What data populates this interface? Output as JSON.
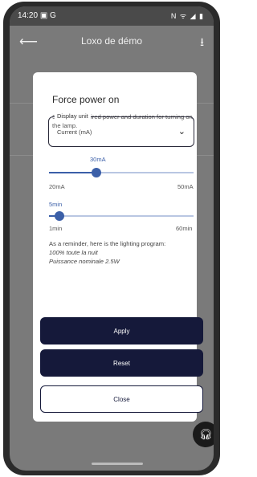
{
  "statusbar": {
    "time": "14:20",
    "left_icons": "▣ G",
    "right_icons": "N ᯤ ◢ ▮"
  },
  "appbar": {
    "title": "Loxo de démo"
  },
  "dialog": {
    "title": "Force power on",
    "description": "Select the desired power and duration for turning on the lamp.",
    "display_unit": {
      "label": "Display unit",
      "value": "Current (mA)"
    },
    "current_slider": {
      "value_label": "30mA",
      "min_label": "20mA",
      "max_label": "50mA",
      "fraction": 0.33
    },
    "duration_slider": {
      "value_label": "5min",
      "min_label": "1min",
      "max_label": "60min",
      "fraction": 0.07
    },
    "reminder": {
      "intro": "As a reminder, here is the lighting program:",
      "line1": "100% toute la nuit",
      "line2": "Puissance nominale 2.5W"
    },
    "buttons": {
      "apply": "Apply",
      "reset": "Reset",
      "close": "Close"
    }
  },
  "colors": {
    "accent": "#3b5fa8",
    "primary_dark": "#15193a",
    "overlay": "#7a7a7a"
  },
  "icons": {
    "back": "arrow-left-icon",
    "download": "download-icon",
    "chevron": "chevron-down-icon",
    "fab": "headset-icon"
  }
}
